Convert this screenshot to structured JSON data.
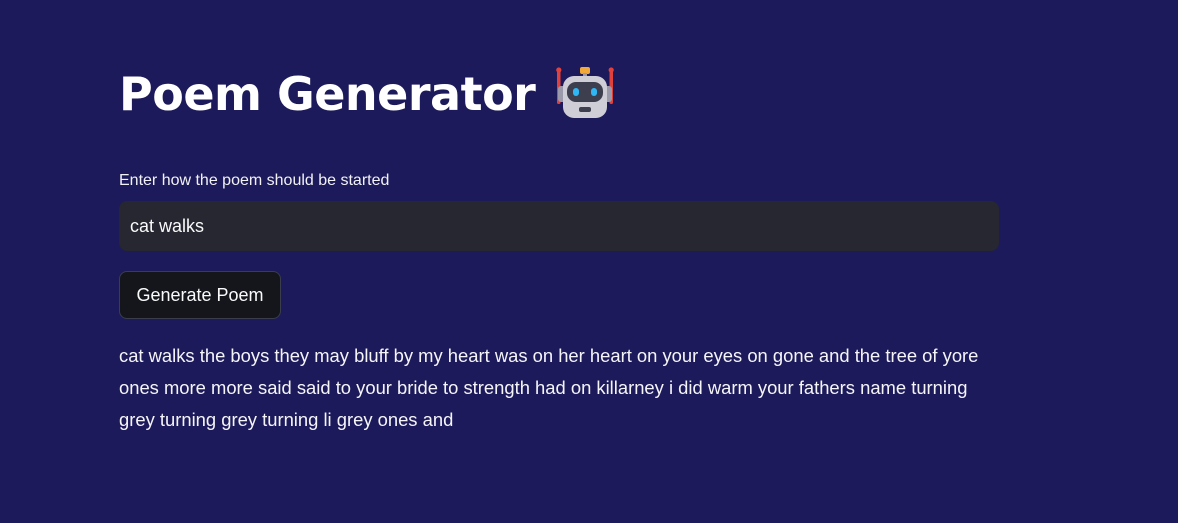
{
  "app": {
    "title": "Poem Generator",
    "title_icon": "robot-icon"
  },
  "form": {
    "input_label": "Enter how the poem should be started",
    "input_value": "cat walks",
    "button_label": "Generate Poem"
  },
  "output": {
    "poem_text": "cat walks the boys they may bluff by my heart was on her heart on your eyes on gone and the tree of yore ones more more said said to your bride to strength had on killarney i did warm your fathers name turning grey turning grey turning li grey ones and"
  },
  "colors": {
    "background": "#1c1a5a",
    "input_background": "#262730",
    "button_background": "#14161c",
    "text": "#ffffff"
  }
}
